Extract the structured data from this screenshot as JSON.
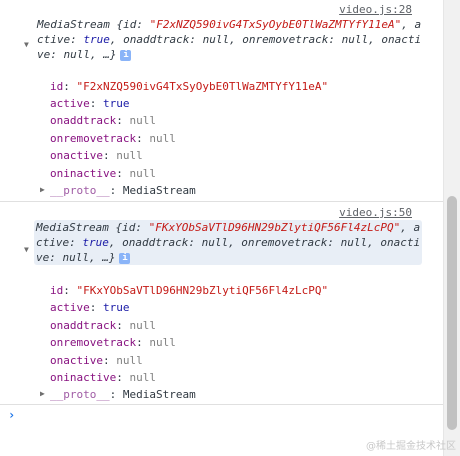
{
  "entries": [
    {
      "source": "video.js:28",
      "summary_prefix": "MediaStream {id: ",
      "summary_id": "\"F2xNZQ590ivG4TxSyOybE0TlWaZMTYfY11eA\"",
      "summary_active_label": ", active: ",
      "summary_active_val": "true",
      "summary_rest": ", onaddtrack: null, onremovetrack: null, onactive: null, …}",
      "props": [
        {
          "key": "id",
          "value": "\"F2xNZQ590ivG4TxSyOybE0TlWaZMTYfY11eA\"",
          "kind": "str"
        },
        {
          "key": "active",
          "value": "true",
          "kind": "bool"
        },
        {
          "key": "onaddtrack",
          "value": "null",
          "kind": "null"
        },
        {
          "key": "onremovetrack",
          "value": "null",
          "kind": "null"
        },
        {
          "key": "onactive",
          "value": "null",
          "kind": "null"
        },
        {
          "key": "oninactive",
          "value": "null",
          "kind": "null"
        }
      ],
      "proto_key": "__proto__",
      "proto_value": "MediaStream"
    },
    {
      "source": "video.js:50",
      "summary_prefix": "MediaStream {id: ",
      "summary_id": "\"FKxYObSaVTlD96HN29bZlytiQF56Fl4zLcPQ\"",
      "summary_active_label": ", active: ",
      "summary_active_val": "true",
      "summary_rest": ", onaddtrack: null, onremovetrack: null, onactive: null, …}",
      "props": [
        {
          "key": "id",
          "value": "\"FKxYObSaVTlD96HN29bZlytiQF56Fl4zLcPQ\"",
          "kind": "str"
        },
        {
          "key": "active",
          "value": "true",
          "kind": "bool"
        },
        {
          "key": "onaddtrack",
          "value": "null",
          "kind": "null"
        },
        {
          "key": "onremovetrack",
          "value": "null",
          "kind": "null"
        },
        {
          "key": "onactive",
          "value": "null",
          "kind": "null"
        },
        {
          "key": "oninactive",
          "value": "null",
          "kind": "null"
        }
      ],
      "proto_key": "__proto__",
      "proto_value": "MediaStream"
    }
  ],
  "info_icon": "i",
  "prompt_symbol": "›",
  "watermark": "@稀土掘金技术社区"
}
